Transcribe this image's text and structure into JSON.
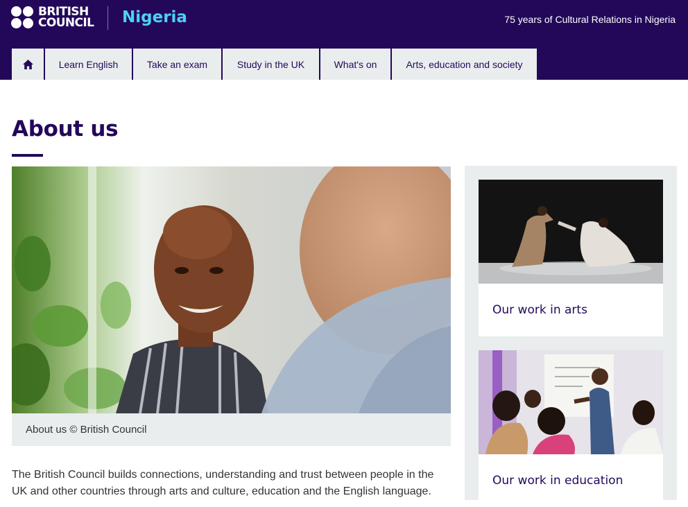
{
  "brand": {
    "logo_line1": "BRITISH",
    "logo_line2": "COUNCIL",
    "country": "Nigeria",
    "tagline": "75 years of Cultural Relations in Nigeria",
    "colors": {
      "primary": "#23085a",
      "accent": "#4ed0f5",
      "panel": "#e9edee"
    }
  },
  "nav": {
    "home_icon": "home-icon",
    "items": [
      {
        "label": "Learn English"
      },
      {
        "label": "Take an exam"
      },
      {
        "label": "Study in the UK"
      },
      {
        "label": "What's on"
      },
      {
        "label": "Arts, education and society"
      }
    ]
  },
  "main": {
    "title": "About us",
    "hero_caption": "About us © British Council",
    "intro": "The British Council builds connections, understanding and trust between people in the UK and other countries through arts and culture, education and the English language."
  },
  "sidebar": {
    "cards": [
      {
        "title": "Our work in arts"
      },
      {
        "title": "Our work in education"
      }
    ]
  }
}
